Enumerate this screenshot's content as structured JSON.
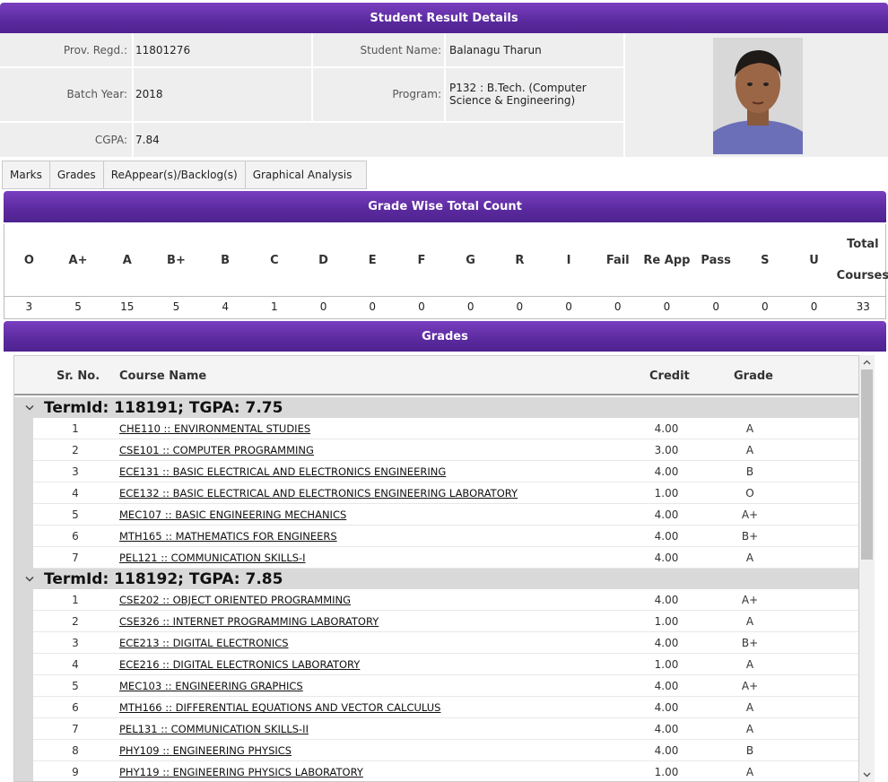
{
  "header": {
    "title": "Student Result Details"
  },
  "info": {
    "prov_regd_label": "Prov. Regd.:",
    "prov_regd": "11801276",
    "student_name_label": "Student Name:",
    "student_name": "Balanagu Tharun",
    "batch_year_label": "Batch Year:",
    "batch_year": "2018",
    "program_label": "Program:",
    "program": "P132 : B.Tech. (Computer Science & Engineering)",
    "cgpa_label": "CGPA:",
    "cgpa": "7.84"
  },
  "tabs": [
    {
      "label": "Marks"
    },
    {
      "label": "Grades"
    },
    {
      "label": "ReAppear(s)/Backlog(s)"
    },
    {
      "label": "Graphical Analysis"
    }
  ],
  "grade_wise": {
    "title": "Grade Wise Total Count",
    "headers": [
      "O",
      "A+",
      "A",
      "B+",
      "B",
      "C",
      "D",
      "E",
      "F",
      "G",
      "R",
      "I",
      "Fail",
      "Re App",
      "Pass",
      "S",
      "U",
      "Total Courses"
    ],
    "values": [
      "3",
      "5",
      "15",
      "5",
      "4",
      "1",
      "0",
      "0",
      "0",
      "0",
      "0",
      "0",
      "0",
      "0",
      "0",
      "0",
      "0",
      "33"
    ]
  },
  "grades": {
    "title": "Grades",
    "columns": {
      "sr": "Sr. No.",
      "name": "Course Name",
      "credit": "Credit",
      "grade": "Grade"
    },
    "terms": [
      {
        "label": "TermId: 118191; TGPA: 7.75",
        "rows": [
          {
            "sr": "1",
            "name": "CHE110 :: ENVIRONMENTAL STUDIES",
            "credit": "4.00",
            "grade": "A"
          },
          {
            "sr": "2",
            "name": "CSE101 :: COMPUTER PROGRAMMING",
            "credit": "3.00",
            "grade": "A"
          },
          {
            "sr": "3",
            "name": "ECE131 :: BASIC ELECTRICAL AND ELECTRONICS ENGINEERING",
            "credit": "4.00",
            "grade": "B"
          },
          {
            "sr": "4",
            "name": "ECE132 :: BASIC ELECTRICAL AND ELECTRONICS ENGINEERING LABORATORY",
            "credit": "1.00",
            "grade": "O"
          },
          {
            "sr": "5",
            "name": "MEC107 :: BASIC ENGINEERING MECHANICS",
            "credit": "4.00",
            "grade": "A+"
          },
          {
            "sr": "6",
            "name": "MTH165 :: MATHEMATICS FOR ENGINEERS",
            "credit": "4.00",
            "grade": "B+"
          },
          {
            "sr": "7",
            "name": "PEL121 :: COMMUNICATION SKILLS-I",
            "credit": "4.00",
            "grade": "A"
          }
        ]
      },
      {
        "label": "TermId: 118192; TGPA: 7.85",
        "rows": [
          {
            "sr": "1",
            "name": "CSE202 :: OBJECT ORIENTED PROGRAMMING",
            "credit": "4.00",
            "grade": "A+"
          },
          {
            "sr": "2",
            "name": "CSE326 :: INTERNET PROGRAMMING LABORATORY",
            "credit": "1.00",
            "grade": "A"
          },
          {
            "sr": "3",
            "name": "ECE213 :: DIGITAL ELECTRONICS",
            "credit": "4.00",
            "grade": "B+"
          },
          {
            "sr": "4",
            "name": "ECE216 :: DIGITAL ELECTRONICS LABORATORY",
            "credit": "1.00",
            "grade": "A"
          },
          {
            "sr": "5",
            "name": "MEC103 :: ENGINEERING GRAPHICS",
            "credit": "4.00",
            "grade": "A+"
          },
          {
            "sr": "6",
            "name": "MTH166 :: DIFFERENTIAL EQUATIONS AND VECTOR CALCULUS",
            "credit": "4.00",
            "grade": "A"
          },
          {
            "sr": "7",
            "name": "PEL131 :: COMMUNICATION SKILLS-II",
            "credit": "4.00",
            "grade": "A"
          },
          {
            "sr": "8",
            "name": "PHY109 :: ENGINEERING PHYSICS",
            "credit": "4.00",
            "grade": "B"
          },
          {
            "sr": "9",
            "name": "PHY119 :: ENGINEERING PHYSICS LABORATORY",
            "credit": "1.00",
            "grade": "A"
          }
        ]
      }
    ]
  },
  "icons": {
    "term_toggle": "chevron-down-icon",
    "scroll_up": "chevron-up-icon",
    "scroll_down": "chevron-down-icon"
  },
  "colors": {
    "header_purple": "#5a2a9e",
    "info_bg": "#eeeeee"
  }
}
